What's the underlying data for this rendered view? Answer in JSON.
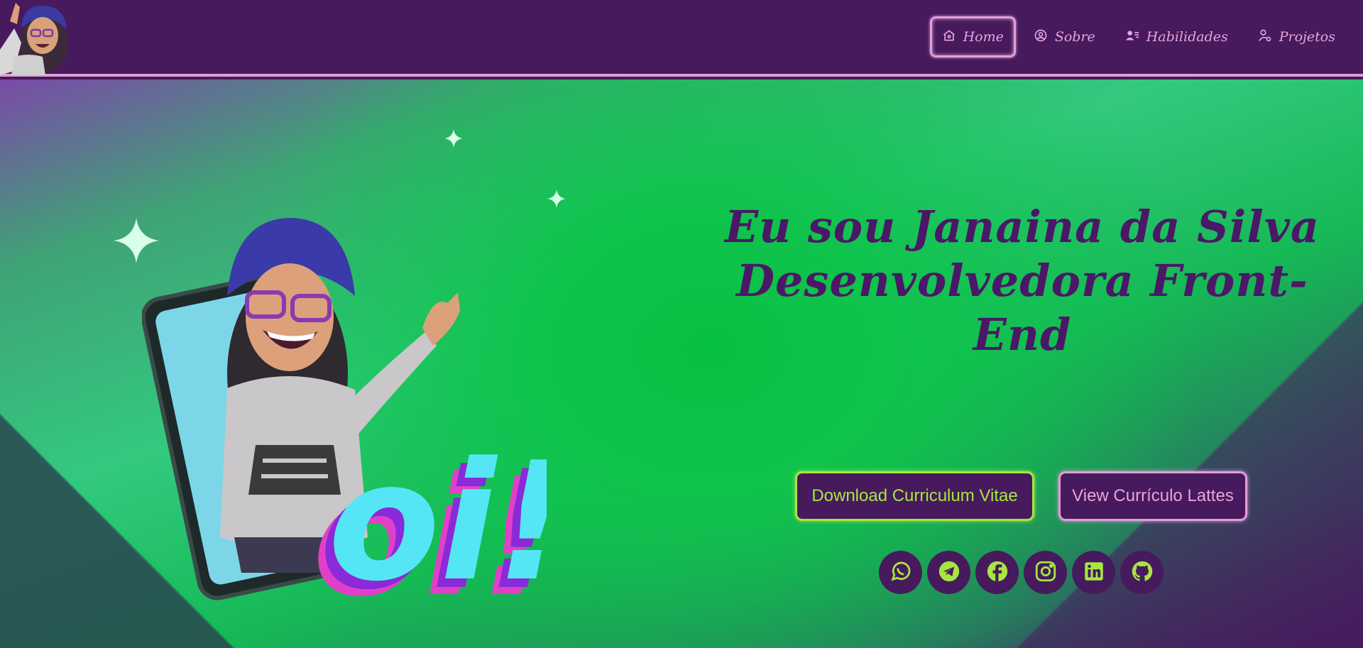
{
  "nav": {
    "items": [
      {
        "label": "Home",
        "icon": "home-icon",
        "active": true
      },
      {
        "label": "Sobre",
        "icon": "user-circle-icon",
        "active": false
      },
      {
        "label": "Habilidades",
        "icon": "user-list-icon",
        "active": false
      },
      {
        "label": "Projetos",
        "icon": "user-gear-icon",
        "active": false
      }
    ]
  },
  "hero": {
    "headline_line1": "Eu sou Janaina da Silva",
    "headline_line2": "Desenvolvedora Front-End",
    "illustration_text": "oi!",
    "cta_download": "Download Curriculum Vitae",
    "cta_lattes": "View Currículo Lattes",
    "social": [
      "whatsapp-icon",
      "telegram-icon",
      "facebook-icon",
      "instagram-icon",
      "linkedin-icon",
      "github-icon"
    ]
  },
  "colors": {
    "navbar_bg": "#461a5c",
    "accent_pink": "#e09ed6",
    "accent_green": "#a6e641",
    "headline": "#4a1867",
    "hero_green": "#0fc34c"
  }
}
